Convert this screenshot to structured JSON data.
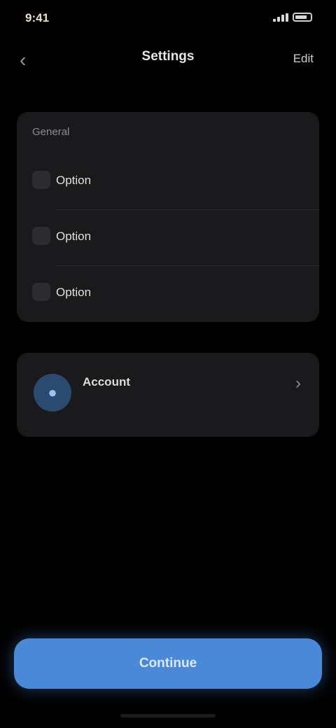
{
  "status_bar": {
    "time": "9:41",
    "battery_icon": "battery-icon",
    "signal_icon": "signal-icon"
  },
  "nav": {
    "back_icon": "chevron-left-icon",
    "back_glyph": "‹",
    "title": "Settings",
    "action_label": "Edit"
  },
  "section": {
    "header": "General",
    "header_right": "",
    "rows": [
      {
        "label": "Option",
        "value": ""
      },
      {
        "label": "Option",
        "value": ""
      },
      {
        "label": "Option",
        "value": ""
      }
    ]
  },
  "account": {
    "avatar_icon": "user-icon",
    "avatar_glyph": "●",
    "name": "Account",
    "subtitle": "",
    "chevron_glyph": "›"
  },
  "primary_button": {
    "label": "Continue"
  },
  "colors": {
    "accent": "#4a88d8",
    "card": "#1a1a1c",
    "background": "#000000"
  }
}
